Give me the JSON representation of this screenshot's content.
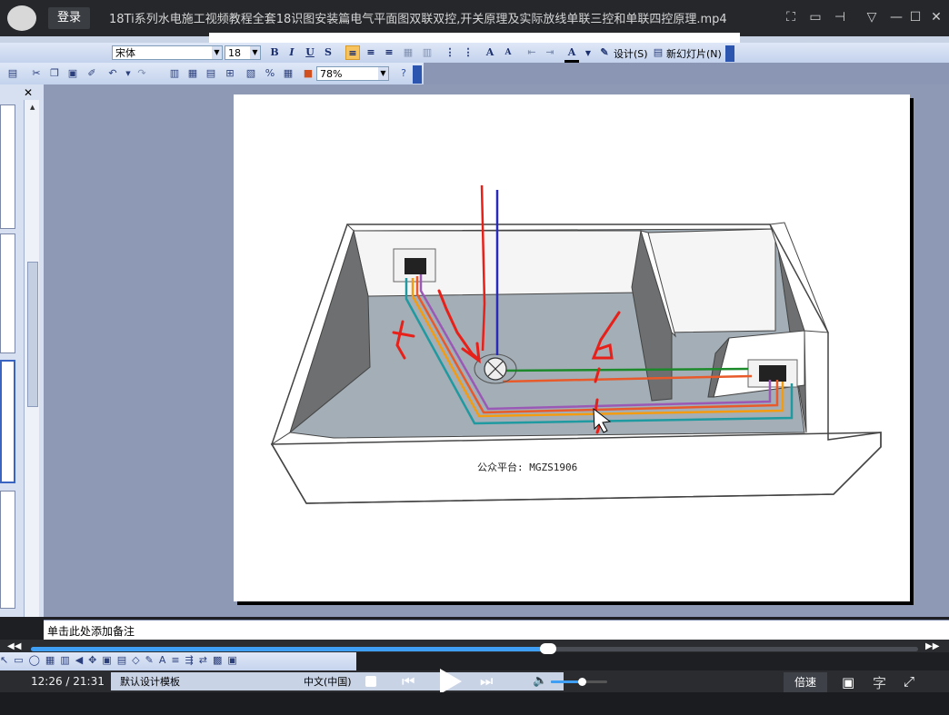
{
  "player": {
    "login_label": "登录",
    "title": "18Ti系列水电施工视频教程全套18识图安装篇电气平面图双联双控,开关原理及实际放线单联三控和单联四控原理.mp4",
    "icons": [
      "screenshot-icon",
      "folder-icon",
      "pin-icon",
      "menu-icon",
      "minimize-icon",
      "maximize-icon",
      "close-icon"
    ]
  },
  "office": {
    "font_name": "宋体",
    "font_size": "18",
    "bold": "B",
    "italic": "I",
    "underline": "U",
    "shadow": "S",
    "design_label": "设计(S)",
    "new_slide_label": "新幻灯片(N)",
    "zoom": "78%",
    "notes_placeholder": "单击此处添加备注",
    "template_name": "默认设计模板",
    "language": "中文(中国)"
  },
  "slide": {
    "caption": "公众平台: MGZS1906"
  },
  "playback": {
    "time": "12:26 / 21:31",
    "progress": 0.5825,
    "volume": 0.55,
    "speed_label": "倍速",
    "subtitle_label": "字",
    "colors": {
      "accent": "#3e9ff4"
    }
  }
}
